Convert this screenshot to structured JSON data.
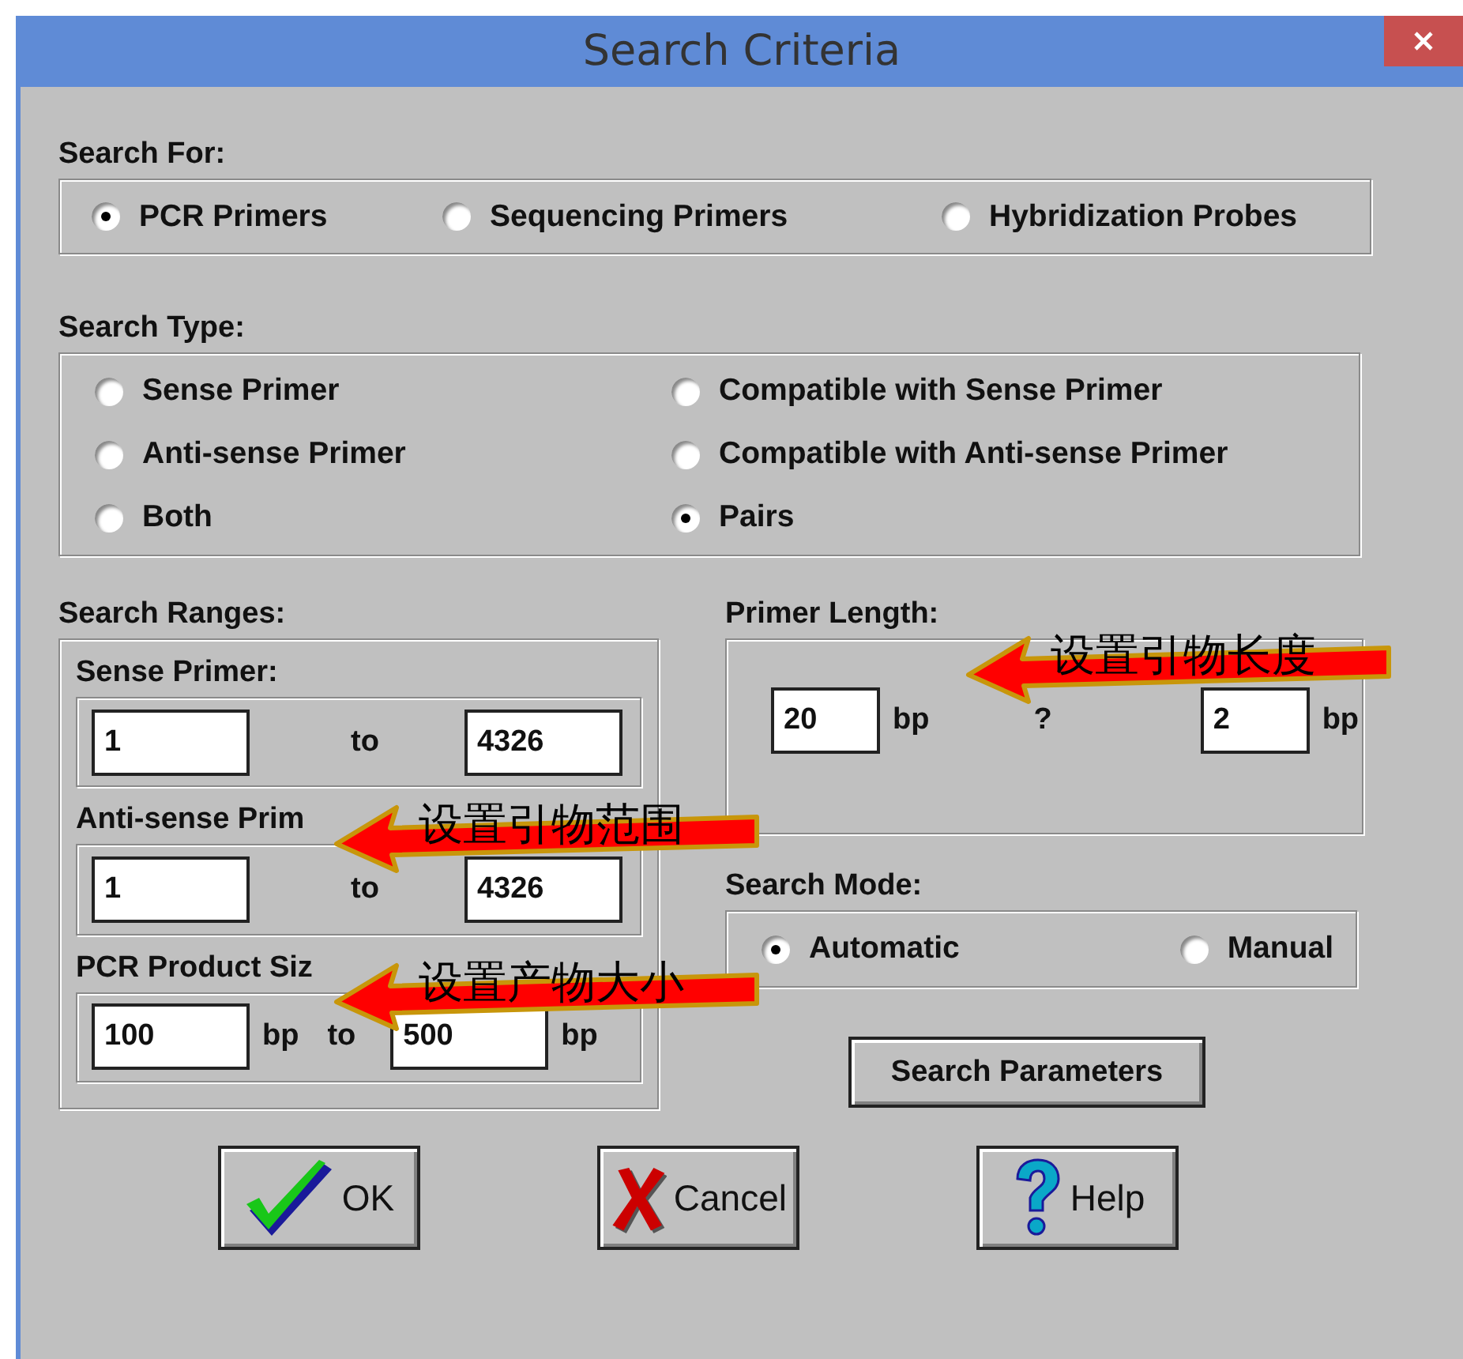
{
  "window": {
    "title": "Search Criteria"
  },
  "search_for": {
    "label": "Search For:",
    "options": [
      {
        "label": "PCR Primers",
        "selected": true
      },
      {
        "label": "Sequencing Primers",
        "selected": false
      },
      {
        "label": "Hybridization Probes",
        "selected": false
      }
    ]
  },
  "search_type": {
    "label": "Search Type:",
    "options": [
      {
        "label": "Sense Primer",
        "selected": false
      },
      {
        "label": "Compatible with Sense Primer",
        "selected": false
      },
      {
        "label": "Anti-sense Primer",
        "selected": false
      },
      {
        "label": "Compatible with Anti-sense Primer",
        "selected": false
      },
      {
        "label": "Both",
        "selected": false
      },
      {
        "label": "Pairs",
        "selected": true
      }
    ]
  },
  "search_ranges": {
    "label": "Search Ranges:",
    "groups": [
      {
        "label": "Sense Primer:",
        "from": "1",
        "to_label": "to",
        "to": "4326"
      },
      {
        "label": "Anti-sense Prim",
        "from": "1",
        "to_label": "to",
        "to": "4326"
      },
      {
        "label": "PCR Product Siz",
        "from": "100",
        "from_unit": "bp",
        "to_label": "to",
        "to": "500",
        "to_unit": "bp"
      }
    ]
  },
  "primer_length": {
    "label": "Primer Length:",
    "value": "20",
    "unit": "bp",
    "separator": "?",
    "tolerance": "2",
    "tolerance_unit": "bp"
  },
  "search_mode": {
    "label": "Search Mode:",
    "options": [
      {
        "label": "Automatic",
        "selected": true
      },
      {
        "label": "Manual",
        "selected": false
      }
    ]
  },
  "search_parameters_button": "Search Parameters",
  "buttons": [
    {
      "kind": "ok",
      "label": "OK"
    },
    {
      "kind": "cancel",
      "label": "Cancel"
    },
    {
      "kind": "help",
      "label": "Help"
    }
  ],
  "annotations": [
    {
      "text": "设置引物长度"
    },
    {
      "text": "设置引物范围"
    },
    {
      "text": "设置产物大小"
    }
  ]
}
